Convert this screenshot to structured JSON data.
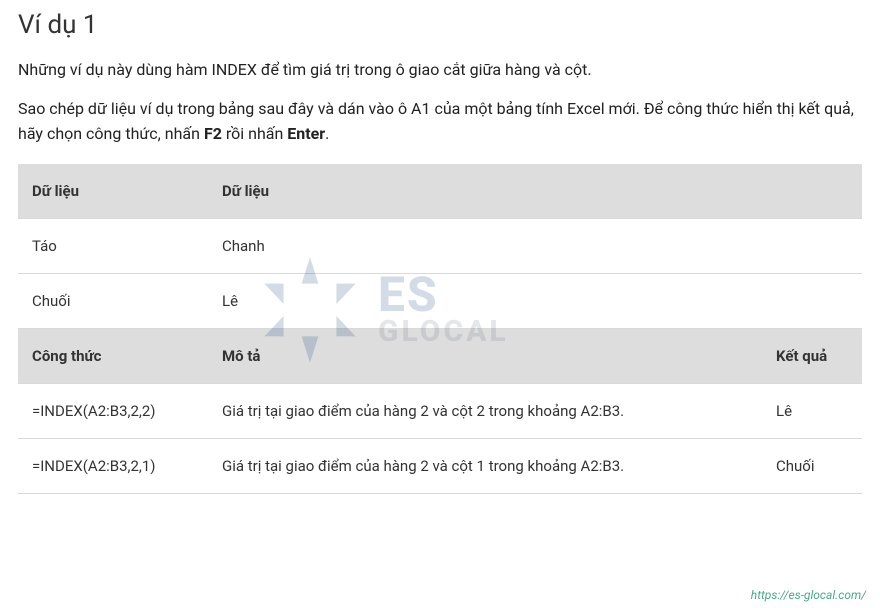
{
  "title": "Ví dụ 1",
  "intro1": "Những ví dụ này dùng hàm INDEX để tìm giá trị trong ô giao cắt giữa hàng và cột.",
  "intro2_pre": "Sao chép dữ liệu ví dụ trong bảng sau đây và dán vào ô A1 của một bảng tính Excel mới. Để công thức hiển thị kết quả, hãy chọn công thức, nhấn ",
  "intro2_b1": "F2",
  "intro2_mid": " rồi nhấn ",
  "intro2_b2": "Enter",
  "intro2_post": ".",
  "table1": {
    "head1": "Dữ liệu",
    "head2": "Dữ liệu",
    "r1c1": "Táo",
    "r1c2": "Chanh",
    "r2c1": "Chuối",
    "r2c2": "Lê"
  },
  "table2": {
    "h1": "Công thức",
    "h2": "Mô tả",
    "h3": "Kết quả",
    "rows": [
      {
        "f": "=INDEX(A2:B3,2,2)",
        "d": "Giá trị tại giao điểm của hàng 2 và cột 2 trong khoảng A2:B3.",
        "r": "Lê"
      },
      {
        "f": "=INDEX(A2:B3,2,1)",
        "d": "Giá trị tại giao điểm của hàng 2 và cột 1 trong khoảng A2:B3.",
        "r": "Chuối"
      }
    ]
  },
  "watermark": {
    "line1": "ES",
    "line2": "GLOCAL"
  },
  "footer_url": "https://es-glocal.com/"
}
